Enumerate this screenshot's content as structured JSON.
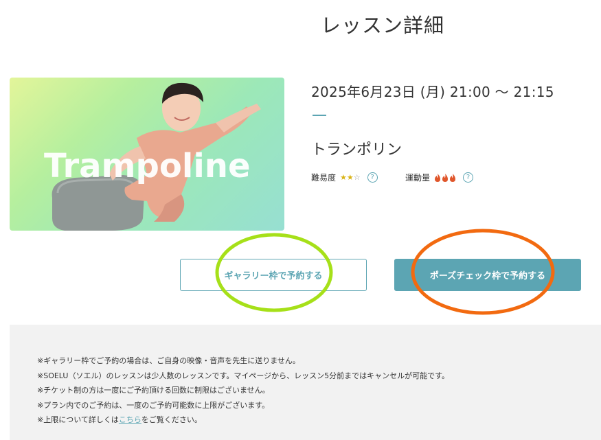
{
  "page": {
    "title": "レッスン詳細"
  },
  "lesson": {
    "image_text": "Trampoline",
    "datetime": "2025年6月23日 (月) 21:00 〜 21:15",
    "name": "トランポリン",
    "difficulty": {
      "label": "難易度",
      "filled_stars": 2,
      "max_stars": 3,
      "help_icon": "question-circle-icon"
    },
    "intensity": {
      "label": "運動量",
      "flames": 3,
      "help_icon": "question-circle-icon"
    }
  },
  "buttons": {
    "gallery": "ギャラリー枠で予約する",
    "pose_check": "ポーズチェック枠で予約する"
  },
  "notes": {
    "items": [
      "※ギャラリー枠でご予約の場合は、ご自身の映像・音声を先生に送りません。",
      "※SOELU（ソエル）のレッスンは少人数のレッスンです。マイページから、レッスン5分前まではキャンセルが可能です。",
      "※チケット制の方は一度にご予約頂ける回数に制限はございません。",
      "※プラン内でのご予約は、一度のご予約可能数に上限がございます。"
    ],
    "last_prefix": "※上限について詳しくは",
    "last_link": "こちら",
    "last_suffix": "をご覧ください。"
  },
  "colors": {
    "accent": "#5ca5b3",
    "star": "#d9b316",
    "flame": "#e0562b",
    "highlight_green": "#a6e019",
    "highlight_orange": "#f26a10",
    "notes_bg": "#f2f2f2"
  }
}
